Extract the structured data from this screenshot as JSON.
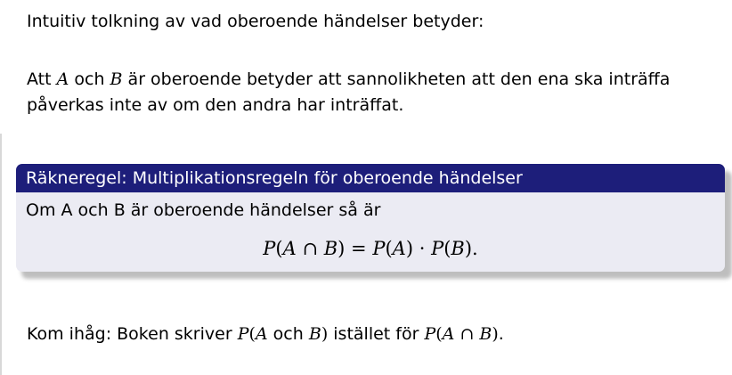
{
  "intro_heading": "Intuitiv tolkning av vad oberoende händelser betyder:",
  "para": {
    "p1_start": "Att ",
    "p1_A": "A",
    "p1_och": " och ",
    "p1_B": "B",
    "p1_rest": " är oberoende betyder att sannolikheten att den ena ska inträffa",
    "p2": "påverkas inte av om den andra har inträffat."
  },
  "block": {
    "title": "Räkneregel: Multiplikationsregeln för oberoende händelser",
    "body_text": "Om A och B är oberoende händelser så är",
    "formula": {
      "lhs_P": "P",
      "lhs_open": "(",
      "lhs_A": "A",
      "lhs_cap": " ∩ ",
      "lhs_B": "B",
      "lhs_close": ")",
      "eq": " = ",
      "rhs1_P": "P",
      "rhs1_open": "(",
      "rhs1_A": "A",
      "rhs1_close": ")",
      "dot": " · ",
      "rhs2_P": "P",
      "rhs2_open": "(",
      "rhs2_B": "B",
      "rhs2_close": ")",
      "period": "."
    }
  },
  "reminder": {
    "start": "Kom ihåg: Boken skriver ",
    "P1": "P",
    "open1": "(",
    "A1": "A",
    "och": " och ",
    "B1": "B",
    "close1": ")",
    "mid": " istället för ",
    "P2": "P",
    "open2": "(",
    "A2": "A",
    "cap": " ∩ ",
    "B2": "B",
    "close2": ")",
    "period": "."
  }
}
